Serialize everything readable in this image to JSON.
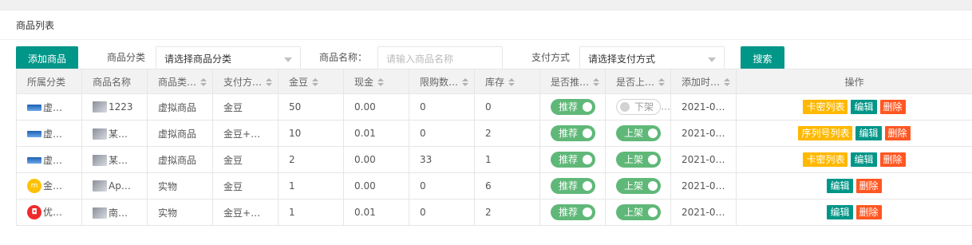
{
  "panel": {
    "title": "商品列表"
  },
  "toolbar": {
    "add_button": "添加商品",
    "category_label": "商品分类",
    "category_select": "请选择商品分类",
    "name_label": "商品名称：",
    "name_placeholder": "请输入商品名称",
    "pay_label": "支付方式",
    "pay_select": "请选择支付方式",
    "search_button": "搜索"
  },
  "table": {
    "headers": [
      "所属分类",
      "商品名称",
      "商品类型",
      "支付方式",
      "金豆",
      "现金",
      "限购数量",
      "库存",
      "是否推荐",
      "是否上架",
      "添加时间",
      "操作"
    ],
    "rows": [
      {
        "category": "虚…",
        "category_icon": "blue-card-icon",
        "name": "1223",
        "name_icon": "product-thumb-icon",
        "type": "虚拟商品",
        "pay": "金豆",
        "beans": "50",
        "cash": "0.00",
        "limit": "0",
        "stock": "0",
        "recommend": "推荐",
        "recommend_on": true,
        "shelf": "下架",
        "shelf_on": false,
        "time": "2021-0…",
        "ops": [
          "卡密列表",
          "编辑",
          "删除"
        ]
      },
      {
        "category": "虚…",
        "category_icon": "blue-card-icon",
        "name": "某…",
        "name_icon": "product-thumb-icon",
        "type": "虚拟商品",
        "pay": "金豆+现金",
        "beans": "10",
        "cash": "0.01",
        "limit": "0",
        "stock": "2",
        "recommend": "推荐",
        "recommend_on": true,
        "shelf": "上架",
        "shelf_on": true,
        "time": "2021-0…",
        "ops": [
          "序列号列表",
          "编辑",
          "删除"
        ]
      },
      {
        "category": "虚…",
        "category_icon": "blue-card-icon",
        "name": "某…",
        "name_icon": "product-thumb-icon",
        "type": "虚拟商品",
        "pay": "金豆",
        "beans": "2",
        "cash": "0.00",
        "limit": "33",
        "stock": "1",
        "recommend": "推荐",
        "recommend_on": true,
        "shelf": "上架",
        "shelf_on": true,
        "time": "2021-0…",
        "ops": [
          "卡密列表",
          "编辑",
          "删除"
        ]
      },
      {
        "category": "金…",
        "category_icon": "yellow-coin-icon",
        "name": "App…",
        "name_icon": "product-thumb-icon",
        "type": "实物",
        "pay": "金豆",
        "beans": "1",
        "cash": "0.00",
        "limit": "0",
        "stock": "6",
        "recommend": "推荐",
        "recommend_on": true,
        "shelf": "上架",
        "shelf_on": true,
        "time": "2021-0…",
        "ops": [
          "编辑",
          "删除"
        ]
      },
      {
        "category": "优…",
        "category_icon": "red-bag-icon",
        "name": "南…",
        "name_icon": "product-thumb-icon",
        "type": "实物",
        "pay": "金豆+现金",
        "beans": "1",
        "cash": "0.01",
        "limit": "0",
        "stock": "2",
        "recommend": "推荐",
        "recommend_on": true,
        "shelf": "上架",
        "shelf_on": true,
        "time": "2021-0…",
        "ops": [
          "编辑",
          "删除"
        ]
      }
    ]
  },
  "colors": {
    "primary": "#009688",
    "toggle_on": "#5fb878",
    "warn": "#ffb800",
    "danger": "#ff5722"
  }
}
